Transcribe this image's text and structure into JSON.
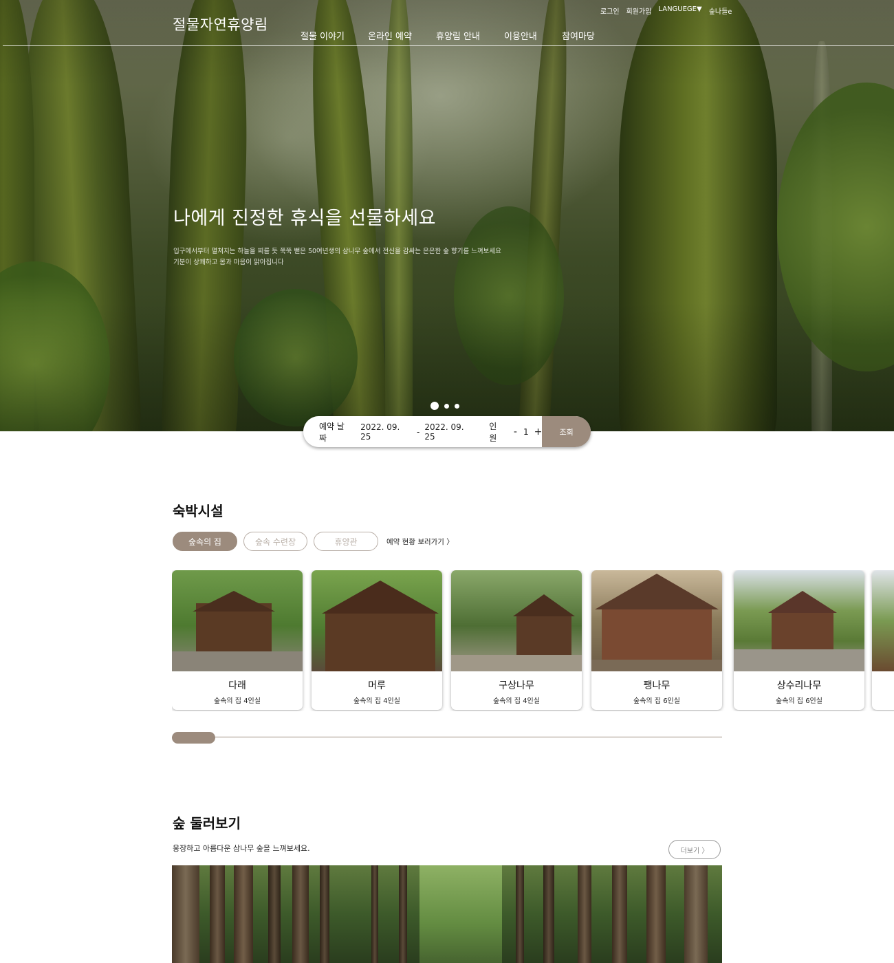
{
  "header": {
    "logo": "절물자연휴양림",
    "util": [
      "로그인",
      "회원가입",
      "LANGUEGE▼",
      "숲나들e"
    ],
    "nav": [
      "절물 이야기",
      "온라인 예약",
      "휴양림 안내",
      "이용안내",
      "참여마당"
    ]
  },
  "hero": {
    "title": "나에게 진정한 휴식을 선물하세요",
    "desc_line1": "입구에서부터 펼쳐지는 하늘을 찌를 듯 쭉쭉 뻗은 50여년생의 삼나무 숲에서 전신을 감싸는 은은한 숲 향기를 느껴보세요",
    "desc_line2": "기분이 상쾌하고 몸과 마음이 맑아집니다",
    "slides": 3,
    "active_slide": 1
  },
  "search": {
    "date_label": "예약 날짜",
    "date_from": "2022. 09. 25",
    "date_sep": "-",
    "date_to": "2022. 09. 25",
    "people_label": "인원",
    "minus": "-",
    "people_count": "1",
    "plus": "+",
    "submit": "조회"
  },
  "lodging": {
    "title": "숙박시설",
    "tabs": [
      "숲속의 집",
      "숲속 수련장",
      "휴양관"
    ],
    "active_tab": "숲속의 집",
    "status_link": "예약 현황 보러가기 〉",
    "cards": [
      {
        "name": "다래",
        "sub": "숲속의 집 4인실"
      },
      {
        "name": "머루",
        "sub": "숲속의 집 4인실"
      },
      {
        "name": "구상나무",
        "sub": "숲속의 집 4인실"
      },
      {
        "name": "팽나무",
        "sub": "숲속의 집  6인실"
      },
      {
        "name": "상수리나무",
        "sub": "숲속의 집 6인실"
      }
    ]
  },
  "forest": {
    "title": "숲 둘러보기",
    "desc": "웅장하고 아름다운 삼나무 숲을 느껴보세요.",
    "more": "더보기 〉"
  },
  "colors": {
    "accent": "#9c8b7d",
    "inactive_tab": "#b8aea6"
  }
}
